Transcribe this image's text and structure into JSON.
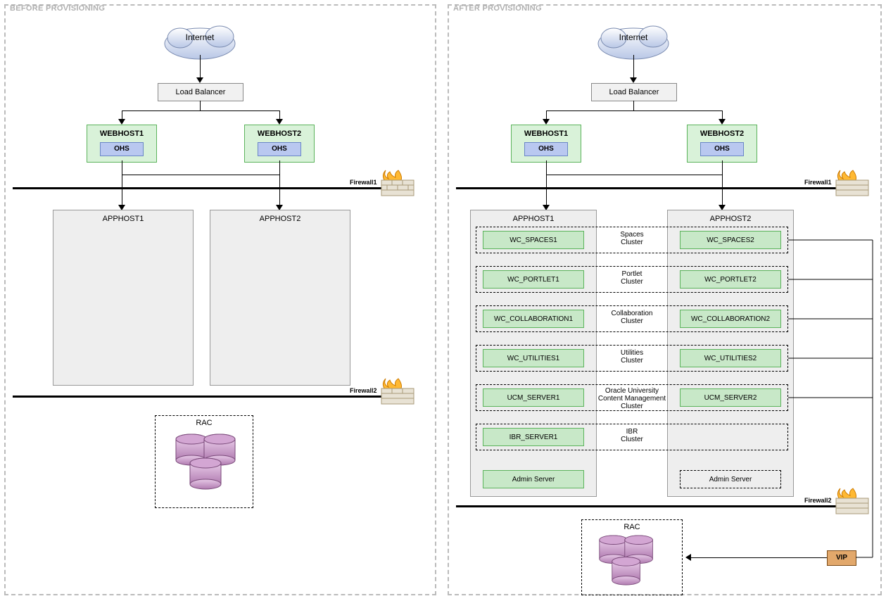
{
  "panels": {
    "before": "BEFORE PROVISIONING",
    "after": "AFTER PROVISIONING"
  },
  "internet": "Internet",
  "load_balancer": "Load Balancer",
  "webhost1": "WEBHOST1",
  "webhost2": "WEBHOST2",
  "ohs": "OHS",
  "apphost1": "APPHOST1",
  "apphost2": "APPHOST2",
  "firewall1": "Firewall1",
  "firewall2": "Firewall2",
  "rac": "RAC",
  "vip": "VIP",
  "clusters": [
    {
      "label": "Spaces\nCluster",
      "left": "WC_SPACES1",
      "right": "WC_SPACES2"
    },
    {
      "label": "Portlet\nCluster",
      "left": "WC_PORTLET1",
      "right": "WC_PORTLET2"
    },
    {
      "label": "Collaboration\nCluster",
      "left": "WC_COLLABORATION1",
      "right": "WC_COLLABORATION2"
    },
    {
      "label": "Utilities\nCluster",
      "left": "WC_UTILITIES1",
      "right": "WC_UTILITIES2"
    },
    {
      "label": "Oracle University\nContent Management\nCluster",
      "left": "UCM_SERVER1",
      "right": "UCM_SERVER2"
    },
    {
      "label": "IBR\nCluster",
      "left": "IBR_SERVER1",
      "right": ""
    }
  ],
  "admin_server": "Admin Server",
  "colors": {
    "green_bg": "#c8e8c8",
    "green_border": "#5bb35b",
    "blue_bg": "#b9c8f0",
    "grey_bg": "#eeeeee",
    "tan": "#e2a86b"
  }
}
